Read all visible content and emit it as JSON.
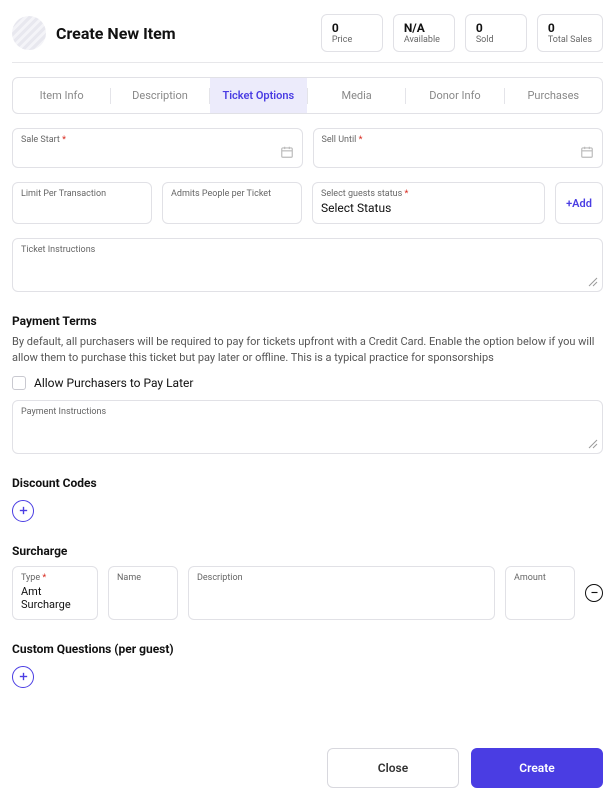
{
  "header": {
    "title": "Create New Item",
    "stats": [
      {
        "value": "0",
        "label": "Price"
      },
      {
        "value": "N/A",
        "label": "Available"
      },
      {
        "value": "0",
        "label": "Sold"
      },
      {
        "value": "0",
        "label": "Total Sales"
      }
    ]
  },
  "tabs": [
    {
      "label": "Item Info"
    },
    {
      "label": "Description"
    },
    {
      "label": "Ticket Options"
    },
    {
      "label": "Media"
    },
    {
      "label": "Donor Info"
    },
    {
      "label": "Purchases"
    }
  ],
  "fields": {
    "sale_start": {
      "label": "Sale Start",
      "required": true
    },
    "sell_until": {
      "label": "Sell Until",
      "required": true
    },
    "limit_per_txn": {
      "label": "Limit Per Transaction"
    },
    "admits": {
      "label": "Admits People per Ticket"
    },
    "guest_status": {
      "label": "Select guests status",
      "required": true,
      "value": "Select Status"
    },
    "add_btn": "+Add",
    "ticket_instructions": {
      "label": "Ticket Instructions"
    }
  },
  "payment": {
    "title": "Payment Terms",
    "desc": "By default, all purchasers will be required to pay for tickets upfront with a Credit Card. Enable the option below if you will allow them to purchase this ticket but pay later or offline. This is a typical practice for sponsorships",
    "checkbox_label": "Allow Purchasers to Pay Later",
    "instructions_label": "Payment Instructions"
  },
  "discount": {
    "title": "Discount Codes"
  },
  "surcharge": {
    "title": "Surcharge",
    "type": {
      "label": "Type",
      "required": true,
      "value": "Amt Surcharge"
    },
    "name": {
      "label": "Name"
    },
    "description": {
      "label": "Description"
    },
    "amount": {
      "label": "Amount"
    }
  },
  "questions": {
    "title": "Custom Questions (per guest)"
  },
  "footer": {
    "close": "Close",
    "create": "Create"
  },
  "req_mark": "*"
}
